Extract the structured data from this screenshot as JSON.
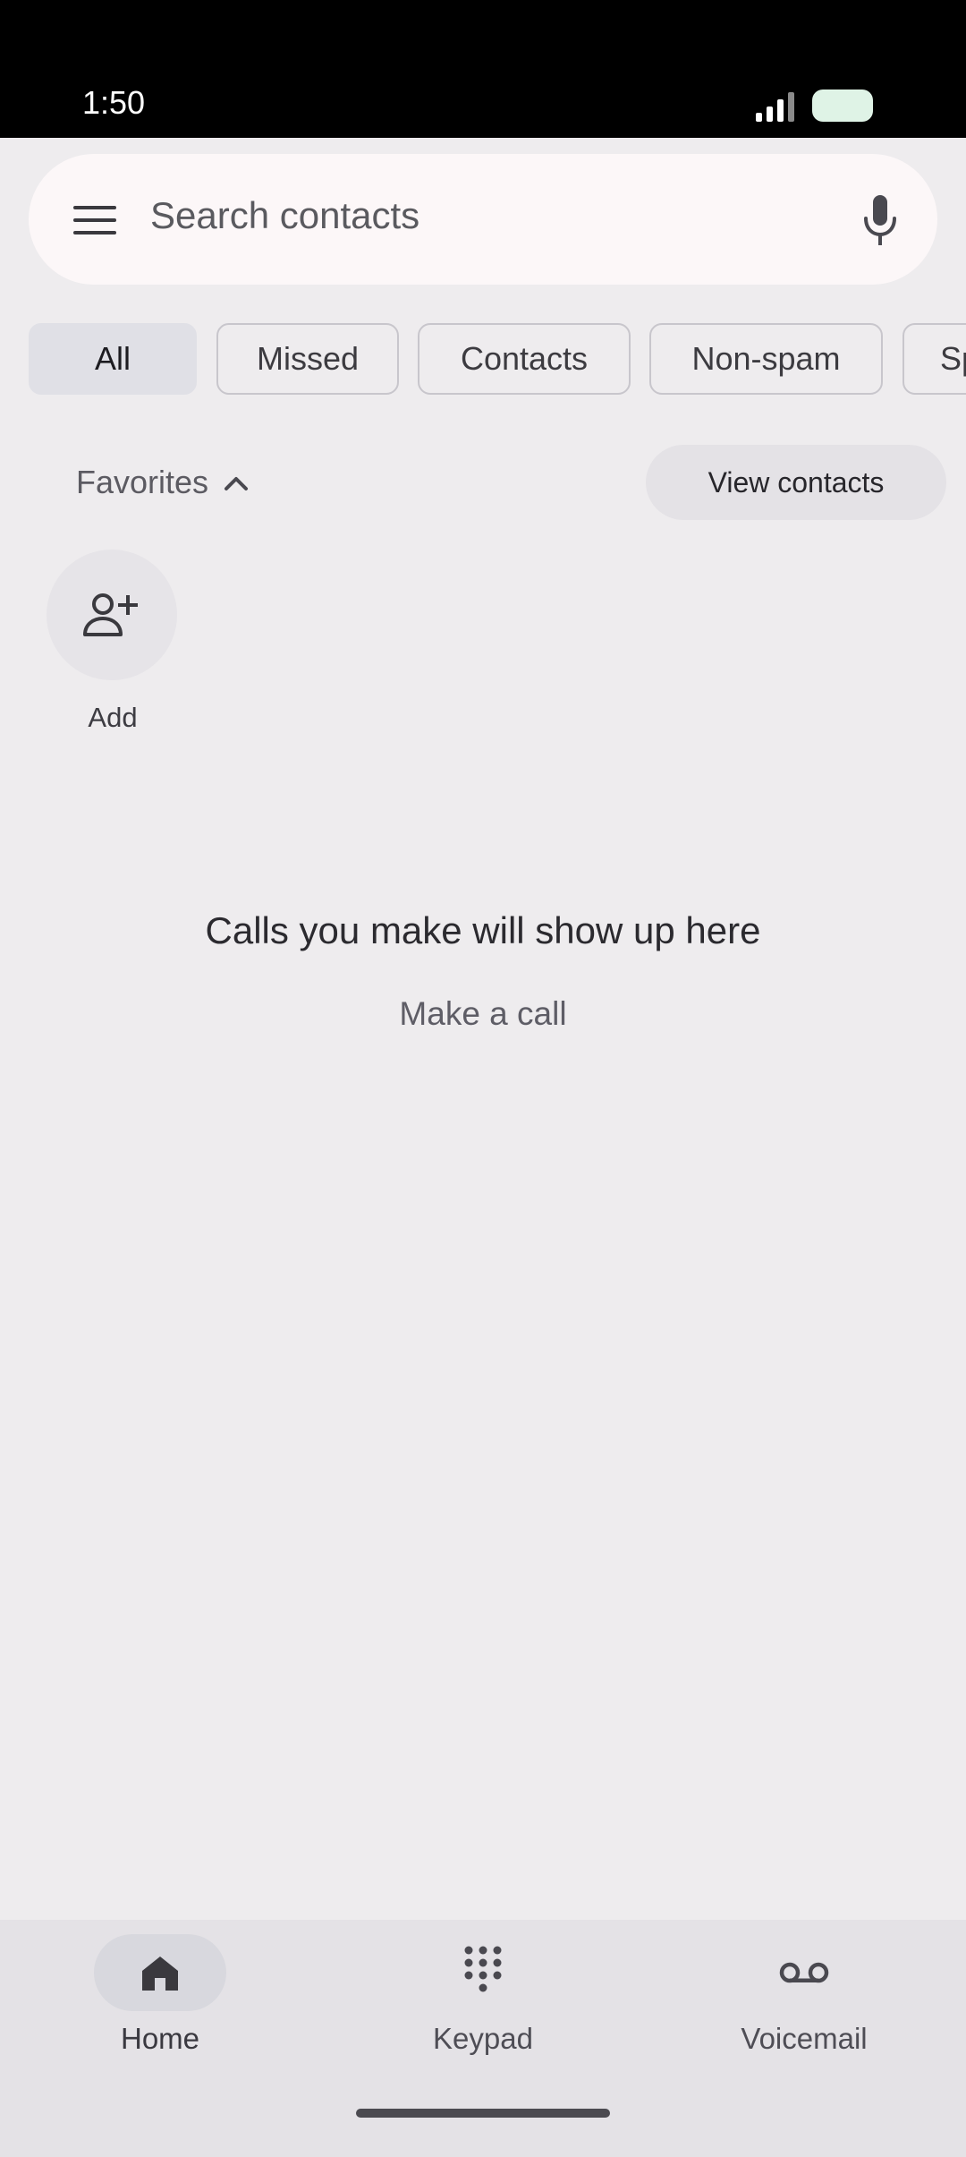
{
  "status_bar": {
    "time": "1:50",
    "icons": [
      "signal-icon",
      "battery-icon"
    ]
  },
  "search": {
    "placeholder": "Search contacts",
    "menu_icon": "menu-icon",
    "mic_icon": "mic-icon"
  },
  "filters": [
    {
      "label": "All",
      "selected": true
    },
    {
      "label": "Missed",
      "selected": false
    },
    {
      "label": "Contacts",
      "selected": false
    },
    {
      "label": "Non-spam",
      "selected": false
    },
    {
      "label": "Sp",
      "selected": false
    }
  ],
  "favorites": {
    "label": "Favorites",
    "view_contacts": "View contacts",
    "add_label": "Add"
  },
  "empty_state": {
    "title": "Calls you make will show up here",
    "action": "Make a call"
  },
  "bottom_nav": [
    {
      "label": "Home",
      "icon": "home-icon",
      "active": true
    },
    {
      "label": "Keypad",
      "icon": "keypad-icon",
      "active": false
    },
    {
      "label": "Voicemail",
      "icon": "voicemail-icon",
      "active": false
    }
  ],
  "colors": {
    "background": "#eeecee",
    "search_bg": "#fcf7f8",
    "chip_selected": "#e0e0e6",
    "nav_bg": "#e4e2e6"
  }
}
